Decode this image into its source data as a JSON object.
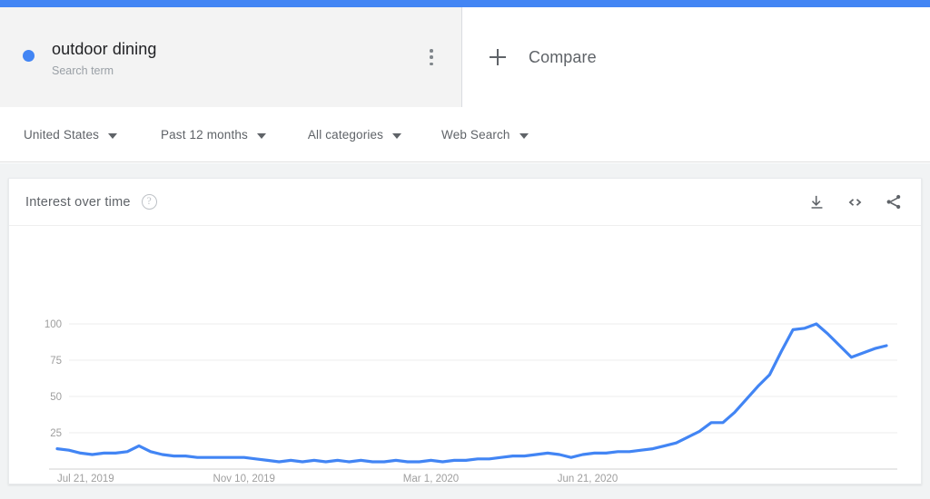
{
  "theme": {
    "accent": "#4285f4",
    "line_color": "#4285f4",
    "card_bg": "#f3f3f3",
    "page_bg": "#f1f3f4"
  },
  "term": {
    "title": "outdoor dining",
    "subtitle": "Search term",
    "dot_color": "#4285f4",
    "menu_icon": "more-vert-icon"
  },
  "compare": {
    "label": "Compare",
    "icon": "plus-icon"
  },
  "filters": [
    {
      "label": "United States",
      "icon": "chevron-down-icon"
    },
    {
      "label": "Past 12 months",
      "icon": "chevron-down-icon"
    },
    {
      "label": "All categories",
      "icon": "chevron-down-icon"
    },
    {
      "label": "Web Search",
      "icon": "chevron-down-icon"
    }
  ],
  "card": {
    "title": "Interest over time",
    "help_glyph": "?",
    "actions": [
      {
        "name": "download-icon",
        "label": "Download"
      },
      {
        "name": "embed-code-icon",
        "label": "Embed"
      },
      {
        "name": "share-icon",
        "label": "Share"
      }
    ]
  },
  "chart_data": {
    "type": "line",
    "title": "Interest over time",
    "xlabel": "",
    "ylabel": "",
    "ylim": [
      0,
      100
    ],
    "yticks": [
      25,
      50,
      75,
      100
    ],
    "ytick_labels": [
      "25",
      "50",
      "75",
      "100"
    ],
    "grid": true,
    "legend": false,
    "xtick_labels": [
      "Jul 21, 2019",
      "Nov 10, 2019",
      "Mar 1, 2020",
      "Jun 21, 2020"
    ],
    "xtick_positions": [
      0,
      16,
      32,
      48
    ],
    "series": [
      {
        "name": "outdoor dining",
        "color": "#4285f4",
        "values": [
          14,
          13,
          11,
          10,
          11,
          11,
          12,
          16,
          12,
          10,
          9,
          9,
          8,
          8,
          8,
          8,
          8,
          7,
          6,
          5,
          6,
          5,
          6,
          5,
          6,
          5,
          6,
          5,
          5,
          6,
          5,
          5,
          6,
          5,
          6,
          6,
          7,
          7,
          8,
          9,
          9,
          10,
          11,
          10,
          8,
          10,
          11,
          11,
          12,
          12,
          13,
          14,
          16,
          18,
          22,
          26,
          32,
          32,
          39,
          48,
          57,
          65,
          81,
          96,
          97,
          100,
          93,
          85,
          77,
          80,
          83,
          85
        ]
      }
    ]
  }
}
